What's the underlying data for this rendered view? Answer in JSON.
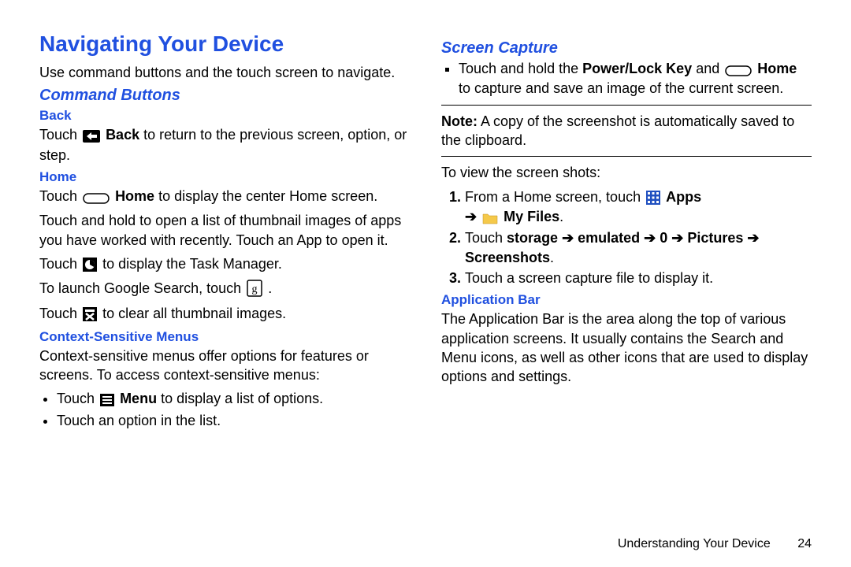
{
  "header": {
    "title": "Navigating Your Device"
  },
  "left": {
    "intro": "Use command buttons and the touch screen to navigate.",
    "cmdButtons": {
      "title": "Command Buttons"
    },
    "back": {
      "title": "Back",
      "p1a": "Touch ",
      "p1b": " Back",
      "p1c": " to return to the previous screen, option, or step."
    },
    "home": {
      "title": "Home",
      "p1a": "Touch ",
      "p1b": " Home",
      "p1c": " to display the center Home screen.",
      "p2": "Touch and hold to open a list of thumbnail images of apps you have worked with recently. Touch an App to open it.",
      "p3a": "Touch ",
      "p3b": " to display the Task Manager.",
      "p4a": "To launch Google Search, touch ",
      "p4b": ".",
      "p5a": "Touch ",
      "p5b": " to clear all thumbnail images."
    },
    "ctx": {
      "title": "Context-Sensitive Menus",
      "p1": "Context-sensitive menus offer options for features or screens. To access context-sensitive menus:",
      "li1a": "Touch ",
      "li1b": " Menu",
      "li1c": " to display a list of options.",
      "li2": "Touch an option in the list."
    }
  },
  "right": {
    "screenCap": {
      "title": "Screen Capture",
      "li1a": "Touch and hold the ",
      "li1b": "Power/Lock Key",
      "li1c": " and ",
      "li1d": " Home",
      "li1e": " to capture and save an image of the current screen.",
      "noteLabel": "Note:",
      "noteText": " A copy of the screenshot is automatically saved to the clipboard.",
      "p2": "To view the screen shots:",
      "ol1a": "From a Home screen, touch ",
      "ol1b": " Apps",
      "ol1c": "➔ ",
      "ol1d": " My Files",
      "ol1e": ".",
      "ol2a": "Touch ",
      "ol2b": "storage ➔ emulated ➔ 0 ➔ Pictures ➔ Screenshots",
      "ol2c": ".",
      "ol3": "Touch a screen capture file to display it."
    },
    "appBar": {
      "title": "Application Bar",
      "p1": "The Application Bar is the area along the top of various application screens. It usually contains the Search and Menu icons, as well as other icons that are used to display options and settings."
    }
  },
  "footer": {
    "chapter": "Understanding Your Device",
    "page": "24"
  },
  "icons": {
    "back": "back-icon",
    "home": "home-capsule-icon",
    "pie": "pie-icon",
    "google": "google-icon",
    "clear": "clear-thumbs-icon",
    "menu": "menu-bars-icon",
    "apps": "apps-grid-icon",
    "folder": "folder-icon"
  }
}
